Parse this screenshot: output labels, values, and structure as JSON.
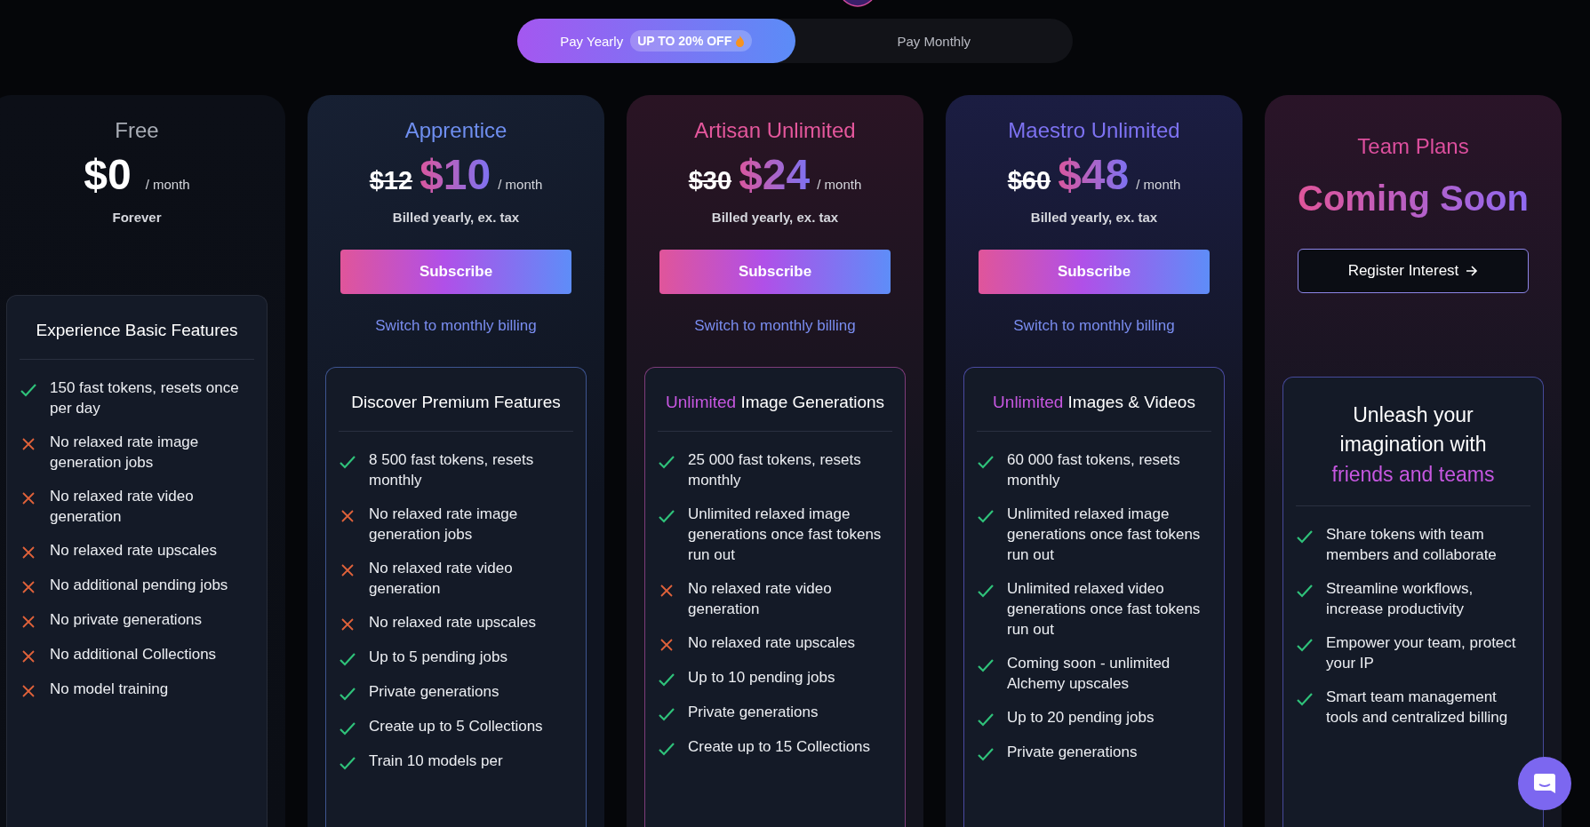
{
  "billing_toggle": [
    {
      "label": "Pay Yearly",
      "badge": "UP TO 20% OFF",
      "selected": true
    },
    {
      "label": "Pay Monthly",
      "selected": false
    }
  ],
  "plans": [
    {
      "kind": "standard",
      "name": "Free",
      "color": "#a9adb6",
      "price": "$0",
      "period": "/ month",
      "note": "Forever",
      "features_header": "Experience Basic Features",
      "features": [
        {
          "text": "150 fast tokens, resets once per day",
          "included": true
        },
        {
          "text": "No relaxed rate image generation jobs",
          "included": false
        },
        {
          "text": "No relaxed rate video generation",
          "included": false
        },
        {
          "text": "No relaxed rate upscales",
          "included": false
        },
        {
          "text": "No additional pending jobs",
          "included": false
        },
        {
          "text": "No private generations",
          "included": false
        },
        {
          "text": "No additional Collections",
          "included": false
        },
        {
          "text": "No model training",
          "included": false
        }
      ]
    },
    {
      "kind": "standard",
      "name": "Apprentice",
      "color": "#6f8ff0",
      "old_price": "$12",
      "price": "$10",
      "period": "/ month",
      "note": "Billed yearly, ex. tax",
      "button": "Subscribe",
      "link": "Switch to monthly billing",
      "features_header": "Discover Premium Features",
      "features": [
        {
          "text": "8 500 fast tokens, resets monthly",
          "included": true
        },
        {
          "text": "No relaxed rate image generation jobs",
          "included": false
        },
        {
          "text": "No relaxed rate video generation",
          "included": false
        },
        {
          "text": "No relaxed rate upscales",
          "included": false
        },
        {
          "text": "Up to 5 pending jobs",
          "included": true
        },
        {
          "text": "Private generations",
          "included": true
        },
        {
          "text": "Create up to 5 Collections",
          "included": true
        },
        {
          "text": "Train 10 models per",
          "included": true
        }
      ]
    },
    {
      "kind": "standard",
      "name": "Artisan Unlimited",
      "color": "#e4579c",
      "old_price": "$30",
      "price": "$24",
      "period": "/ month",
      "note": "Billed yearly, ex. tax",
      "button": "Subscribe",
      "link": "Switch to monthly billing",
      "features_accent": "Unlimited",
      "features_header": "Image Generations",
      "features": [
        {
          "text": "25 000 fast tokens, resets monthly",
          "included": true
        },
        {
          "text": "Unlimited relaxed image generations once fast tokens run out",
          "included": true
        },
        {
          "text": "No relaxed rate video generation",
          "included": false
        },
        {
          "text": "No relaxed rate upscales",
          "included": false
        },
        {
          "text": "Up to 10 pending jobs",
          "included": true
        },
        {
          "text": "Private generations",
          "included": true
        },
        {
          "text": "Create up to 15 Collections",
          "included": true
        }
      ]
    },
    {
      "kind": "standard",
      "name": "Maestro Unlimited",
      "color": "#7d72f2",
      "old_price": "$60",
      "price": "$48",
      "period": "/ month",
      "note": "Billed yearly, ex. tax",
      "button": "Subscribe",
      "link": "Switch to monthly billing",
      "features_accent": "Unlimited",
      "features_header": "Images & Videos",
      "features": [
        {
          "text": "60 000 fast tokens, resets monthly",
          "included": true
        },
        {
          "text": "Unlimited relaxed image generations once fast tokens run out",
          "included": true
        },
        {
          "text": "Unlimited relaxed video generations once fast tokens run out",
          "included": true
        },
        {
          "text": "Coming soon - unlimited Alchemy upscales",
          "included": true
        },
        {
          "text": "Up to 20 pending jobs",
          "included": true
        },
        {
          "text": "Private generations",
          "included": true
        }
      ]
    },
    {
      "kind": "team",
      "name": "Team Plans",
      "color": "#dd4f9e",
      "headline": "Coming Soon",
      "button": "Register Interest",
      "features_header": "Unleash your imagination with",
      "features_accent": "friends and teams",
      "features": [
        {
          "text": "Share tokens with team members and collaborate",
          "included": true
        },
        {
          "text": "Streamline workflows, increase productivity",
          "included": true
        },
        {
          "text": "Empower your team, protect your IP",
          "included": true
        },
        {
          "text": "Smart team management tools and centralized billing",
          "included": true
        }
      ]
    }
  ]
}
